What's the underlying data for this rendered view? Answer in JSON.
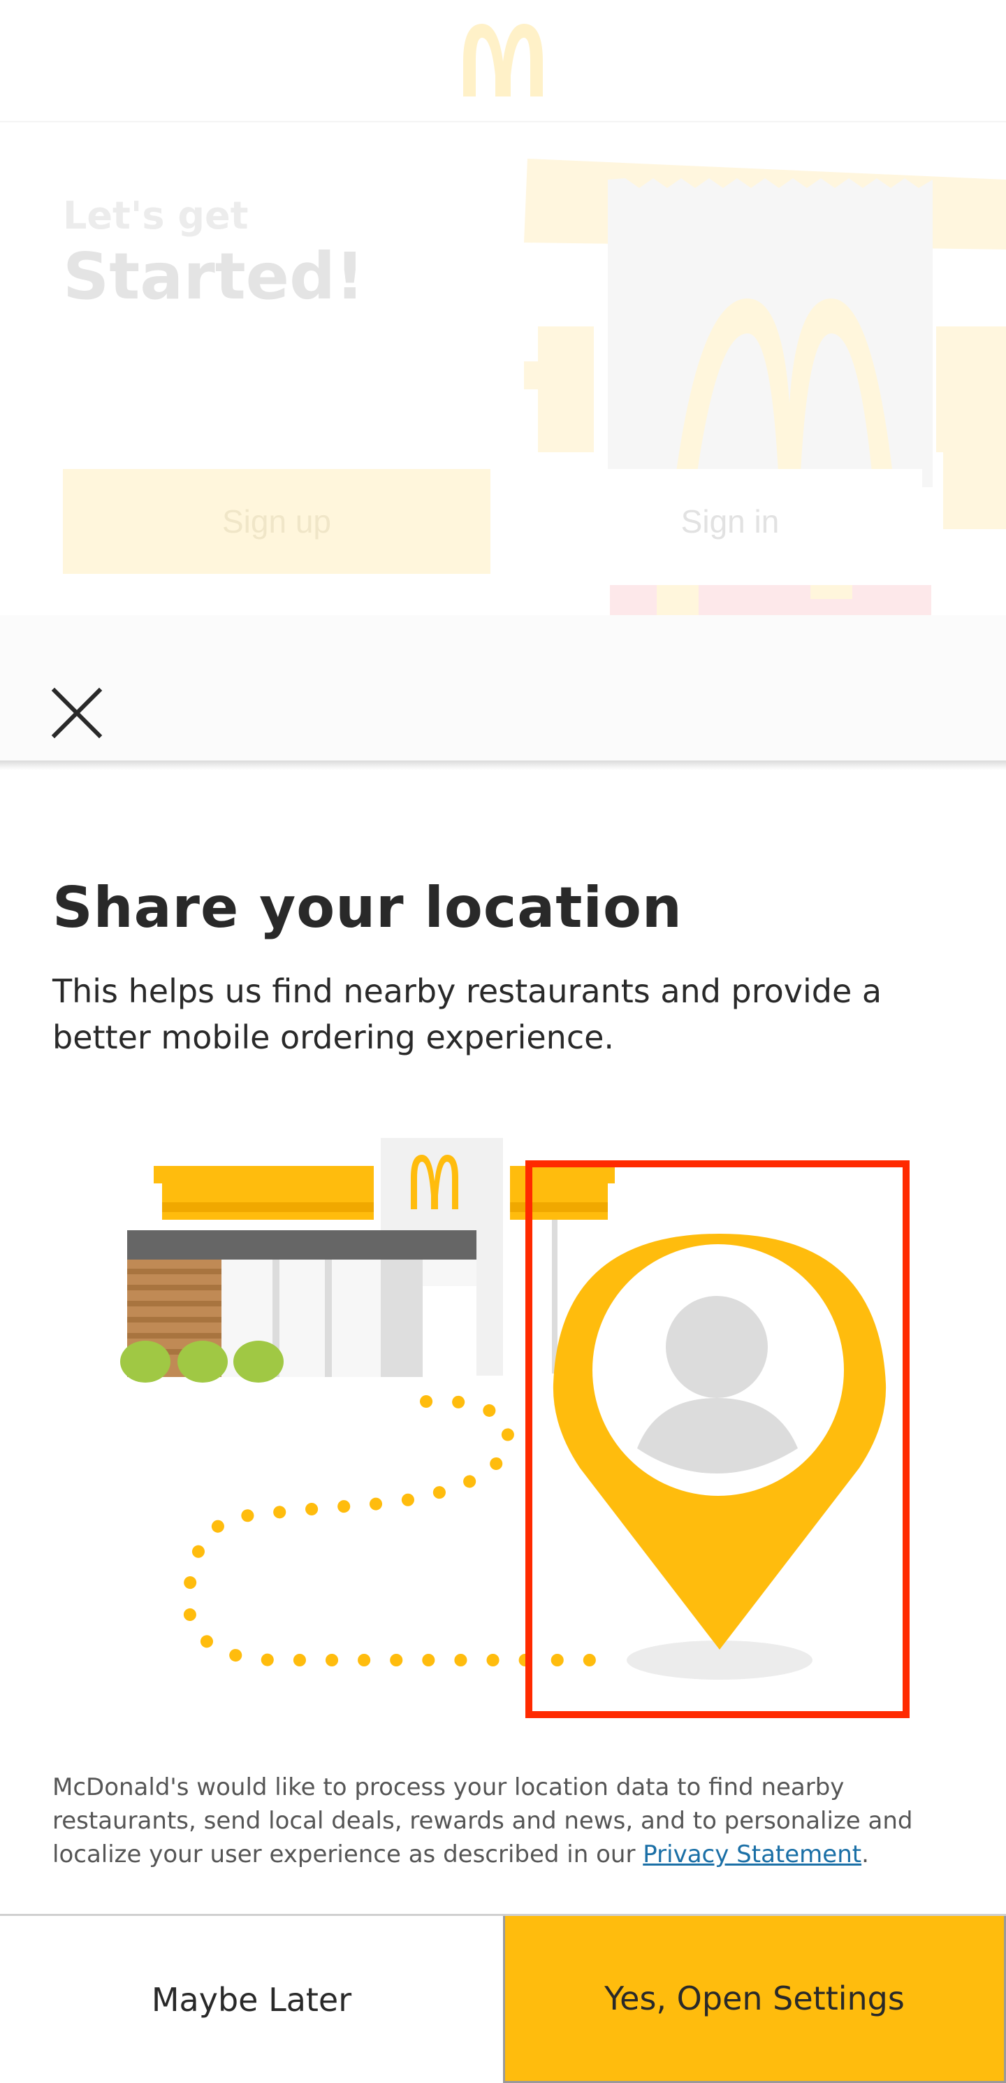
{
  "background_page": {
    "eyebrow": "Let's get",
    "title": "Started!",
    "signup_label": "Sign up",
    "signin_label": "Sign in"
  },
  "modal": {
    "title": "Share your location",
    "description": "This helps us find nearby restaurants and provide a better mobile ordering experience.",
    "consent_text": "McDonald's would like to process your location data to find nearby restaurants, send local deals, rewards and news, and to personalize and localize your user experience as described in our ",
    "privacy_link": "Privacy Statement",
    "consent_end": ".",
    "maybe_later_label": "Maybe Later",
    "open_settings_label": "Yes, Open Settings"
  },
  "icons": {
    "close": "close-icon",
    "logo": "golden-arches-logo",
    "location_pin": "location-pin-icon",
    "user_avatar": "user-avatar-icon"
  },
  "colors": {
    "brand_yellow": "#ffbc0d",
    "highlight_box": "#ff2a00",
    "text_primary": "#292929",
    "link": "#1a6fa6"
  }
}
